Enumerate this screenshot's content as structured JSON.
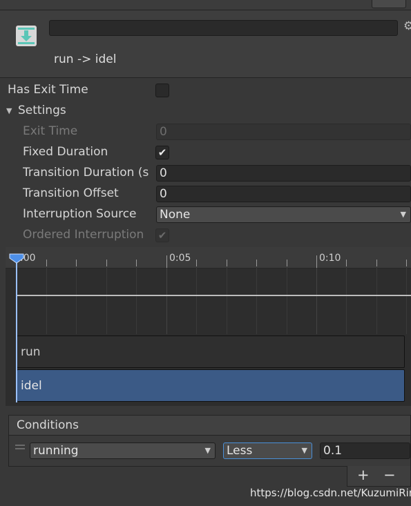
{
  "header": {
    "title": "run -> idel",
    "name_value": ""
  },
  "properties": {
    "has_exit_time": {
      "label": "Has Exit Time",
      "checked": false
    },
    "settings": {
      "label": "Settings",
      "expanded": true
    },
    "exit_time": {
      "label": "Exit Time",
      "value": "0",
      "enabled": false
    },
    "fixed_duration": {
      "label": "Fixed Duration",
      "checked": true
    },
    "transition_duration": {
      "label": "Transition Duration (s",
      "value": "0"
    },
    "transition_offset": {
      "label": "Transition Offset",
      "value": "0"
    },
    "interruption_source": {
      "label": "Interruption Source",
      "value": "None"
    },
    "ordered_interruption": {
      "label": "Ordered Interruption",
      "checked": true,
      "enabled": false
    }
  },
  "timeline": {
    "ticks": [
      ":00",
      "0:05",
      "0:10"
    ],
    "clips": [
      {
        "label": "run",
        "selected": false
      },
      {
        "label": "idel",
        "selected": true
      }
    ]
  },
  "conditions": {
    "title": "Conditions",
    "rows": [
      {
        "parameter": "running",
        "operator": "Less",
        "threshold": "0.1"
      }
    ],
    "add_label": "+",
    "remove_label": "−"
  },
  "watermark": "https://blog.csdn.net/KuzumiRin",
  "colors": {
    "panel": "#383838",
    "field": "#2a2a2a",
    "selected_clip": "#3b5a86",
    "accent_focus": "#4a90d9"
  }
}
